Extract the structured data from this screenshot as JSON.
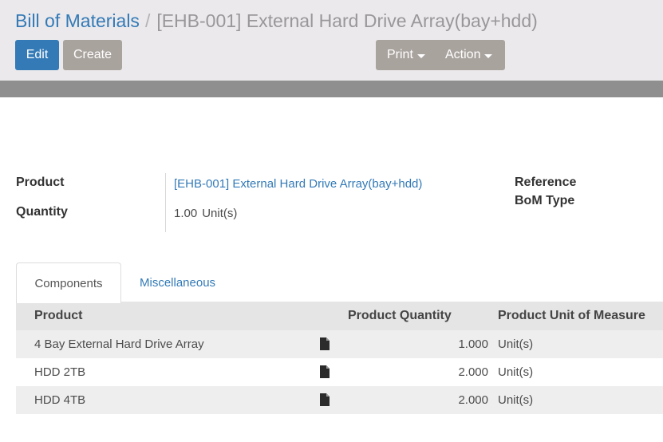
{
  "breadcrumb": {
    "parent": "Bill of Materials",
    "separator": "/",
    "current": "[EHB-001] External Hard Drive Array(bay+hdd)"
  },
  "buttons": {
    "edit": "Edit",
    "create": "Create",
    "print": "Print",
    "action": "Action"
  },
  "form": {
    "product_label": "Product",
    "quantity_label": "Quantity",
    "product_value": "[EHB-001] External Hard Drive Array(bay+hdd)",
    "quantity_value": "1.00",
    "quantity_unit": "Unit(s)",
    "reference_label": "Reference",
    "bom_type_label": "BoM Type"
  },
  "tabs": [
    {
      "label": "Components",
      "active": true
    },
    {
      "label": "Miscellaneous",
      "active": false
    }
  ],
  "table": {
    "headers": [
      "Product",
      "Product Quantity",
      "Product Unit of Measure"
    ],
    "rows": [
      {
        "product": "4 Bay External Hard Drive Array",
        "qty": "1.000",
        "uom": "Unit(s)"
      },
      {
        "product": "HDD 2TB",
        "qty": "2.000",
        "uom": "Unit(s)"
      },
      {
        "product": "HDD 4TB",
        "qty": "2.000",
        "uom": "Unit(s)"
      }
    ]
  },
  "icons": {
    "row_action": "document-icon"
  },
  "colors": {
    "accent": "#337ab7",
    "secondary_button": "#a9a39e",
    "header_bg": "#ebe9eb"
  }
}
